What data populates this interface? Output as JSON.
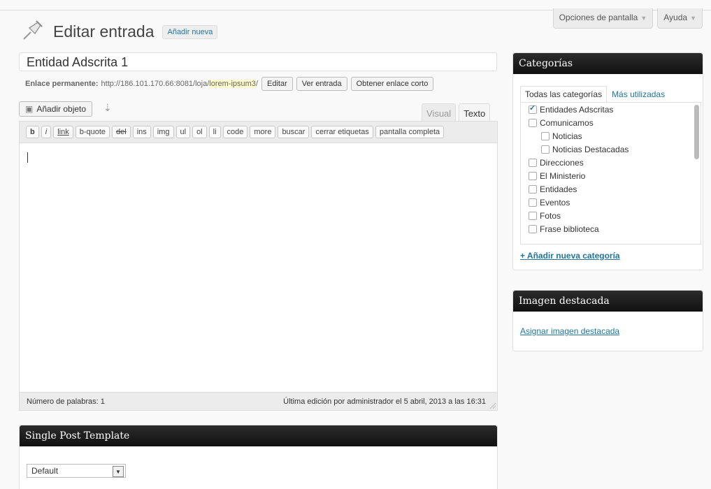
{
  "screen_meta": {
    "screen_options": "Opciones de pantalla",
    "help": "Ayuda"
  },
  "header": {
    "title": "Editar entrada",
    "add_new": "Añadir nueva"
  },
  "post": {
    "title": "Entidad Adscrita 1",
    "permalink_label": "Enlace permanente:",
    "permalink_base": "http://186.101.170.66:8081/loja/",
    "permalink_slug": "lorem-ipsum3",
    "permalink_trail": "/",
    "edit_btn": "Editar",
    "view_btn": "Ver entrada",
    "shortlink_btn": "Obtener enlace corto"
  },
  "editor": {
    "add_media": "Añadir objeto",
    "tab_visual": "Visual",
    "tab_text": "Texto",
    "quicktags": [
      "b",
      "i",
      "link",
      "b-quote",
      "del",
      "ins",
      "img",
      "ul",
      "ol",
      "li",
      "code",
      "more",
      "buscar",
      "cerrar etiquetas",
      "pantalla completa"
    ],
    "word_count": "Número de palabras: 1",
    "last_edit": "Última edición por administrador el 5 abril, 2013 a las 16:31"
  },
  "categories": {
    "title": "Categorías",
    "tab_all": "Todas las categorías",
    "tab_popular": "Más utilizadas",
    "items": [
      {
        "label": "Entidades Adscritas",
        "checked": true,
        "level": 0
      },
      {
        "label": "Comunicamos",
        "checked": false,
        "level": 0
      },
      {
        "label": "Noticias",
        "checked": false,
        "level": 1
      },
      {
        "label": "Noticias Destacadas",
        "checked": false,
        "level": 1
      },
      {
        "label": "Direcciones",
        "checked": false,
        "level": 0
      },
      {
        "label": "El Ministerio",
        "checked": false,
        "level": 0
      },
      {
        "label": "Entidades",
        "checked": false,
        "level": 0
      },
      {
        "label": "Eventos",
        "checked": false,
        "level": 0
      },
      {
        "label": "Fotos",
        "checked": false,
        "level": 0
      },
      {
        "label": "Frase biblioteca",
        "checked": false,
        "level": 0
      }
    ],
    "add_new": "+ Añadir nueva categoría"
  },
  "featured": {
    "title": "Imagen destacada",
    "link": "Asignar imagen destacada"
  },
  "template": {
    "title": "Single Post Template",
    "selected": "Default"
  }
}
